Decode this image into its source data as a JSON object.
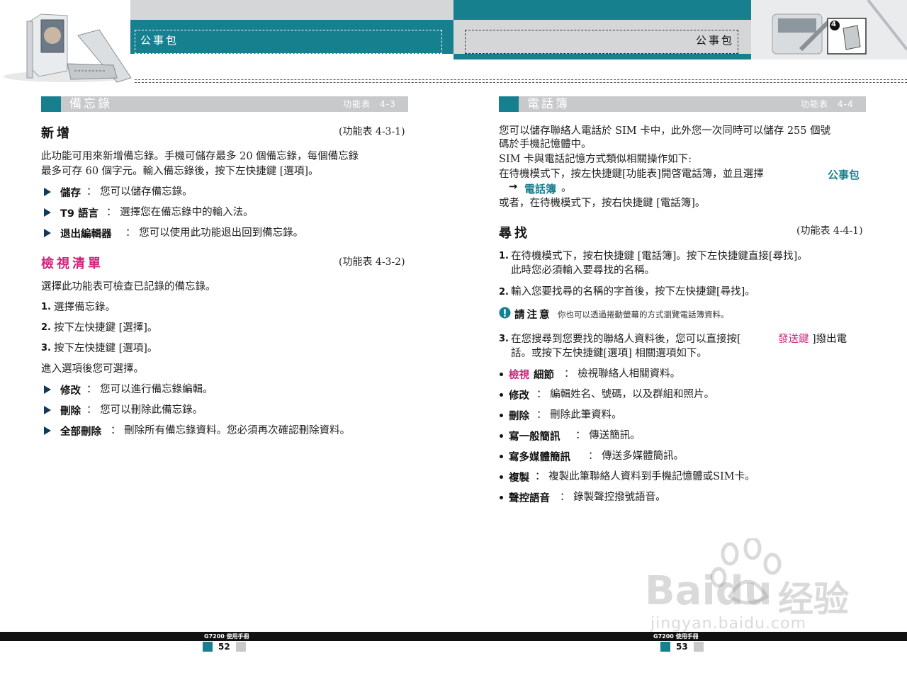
{
  "header": {
    "left_title": "公事包",
    "right_title": "公事包",
    "badge_number": "4"
  },
  "left": {
    "section": {
      "title": "備忘錄",
      "ref": "功能表　4-3"
    },
    "new": {
      "heading": "新增",
      "ref": "(功能表 4-3-1)",
      "para1": "此功能可用來新增備忘錄。手機可儲存最多 20 個備忘錄，每個備忘錄",
      "para2": "最多可存 60 個字元。輸入備忘錄後，按下左快捷鍵 [選項]。",
      "items": [
        {
          "label": "儲存",
          "text": "：  您可以儲存備忘錄。"
        },
        {
          "label": "T9 語言",
          "text": "：  選擇您在備忘錄中的輸入法。"
        },
        {
          "label": "退出編輯器",
          "text": "：  您可以使用此功能退出回到備忘錄。"
        }
      ]
    },
    "view": {
      "heading": "檢視清單",
      "ref": "(功能表 4-3-2)",
      "intro": "選擇此功能表可檢查已記錄的備忘錄。",
      "steps": [
        {
          "n": "1.",
          "text": "選擇備忘錄。"
        },
        {
          "n": "2.",
          "text": "按下左快捷鍵 [選擇]。"
        },
        {
          "n": "3.",
          "text": "按下左快捷鍵 [選項]。"
        }
      ],
      "after": "進入選項後您可選擇。",
      "items": [
        {
          "label": "修改",
          "text": "：  您可以進行備忘錄編輯。"
        },
        {
          "label": "刪除",
          "text": "：  您可以刪除此備忘錄。"
        },
        {
          "label": "全部刪除",
          "text": "：  刪除所有備忘錄資料。您必須再次確認刪除資料。"
        }
      ]
    },
    "footer": {
      "label": "G7200 使用手冊",
      "page": "52"
    }
  },
  "right": {
    "section": {
      "title": "電話簿",
      "ref": "功能表　4-4"
    },
    "intro": {
      "line1": "您可以儲存聯絡人電話於 SIM 卡中，此外您一次同時可以儲存 255 個號",
      "line2": "碼於手機記憶體中。",
      "line3": "SIM 卡與電話記憶方式類似相關操作如下:",
      "line4": "在待機模式下，按左快捷鍵[功能表]開啓電話簿，並且選擇",
      "link1": "公事包",
      "arrow": "→",
      "link2": "電話簿",
      "period": "。",
      "line5": "或者，在待機模式下，按右快捷鍵 [電話簿]。"
    },
    "search": {
      "heading": "尋找",
      "ref": "(功能表 4-4-1)",
      "step1_n": "1.",
      "step1_a": "在待機模式下，按右快捷鍵 [電話簿]。按下左快捷鍵直接[尋找]。",
      "step1_b": "此時您必須輸入要尋找的名稱。",
      "step2_n": "2.",
      "step2": "輸入您要找尋的名稱的字首後，按下左快捷鍵[尋找]。",
      "note_label": "請注意",
      "note_text": "你也可以透過捲動螢幕的方式瀏覽電話簿資料。",
      "step3_n": "3.",
      "step3_a1": "在您搜尋到您要找的聯絡人資料後，您可以直接按[",
      "step3_send": "發送鍵",
      "step3_a2": "]撥出電",
      "step3_b": "話。或按下左快捷鍵[選項] 相關選項如下。",
      "options": [
        {
          "label_a": "檢視",
          "label_b": "細節",
          "text": "：  檢視聯絡人相關資料。"
        },
        {
          "label_a": "",
          "label_b": "修改",
          "text": "：  編輯姓名、號碼，以及群組和照片。"
        },
        {
          "label_a": "",
          "label_b": "刪除",
          "text": "：  刪除此筆資料。"
        },
        {
          "label_a": "",
          "label_b": "寫一般簡訊",
          "text": "：  傳送簡訊。"
        },
        {
          "label_a": "",
          "label_b": "寫多媒體簡訊",
          "text": "：  傳送多媒體簡訊。"
        },
        {
          "label_a": "",
          "label_b": "複製",
          "text": "：  複製此筆聯絡人資料到手機記憶體或SIM卡。"
        },
        {
          "label_a": "",
          "label_b": "聲控語音",
          "text": "：  錄製聲控撥號語音。"
        }
      ]
    },
    "footer": {
      "label": "G7200 使用手冊",
      "page": "53"
    }
  },
  "watermark": {
    "brand": "Baidu",
    "suffix": "经验",
    "url": "jingyan.baidu.com"
  }
}
